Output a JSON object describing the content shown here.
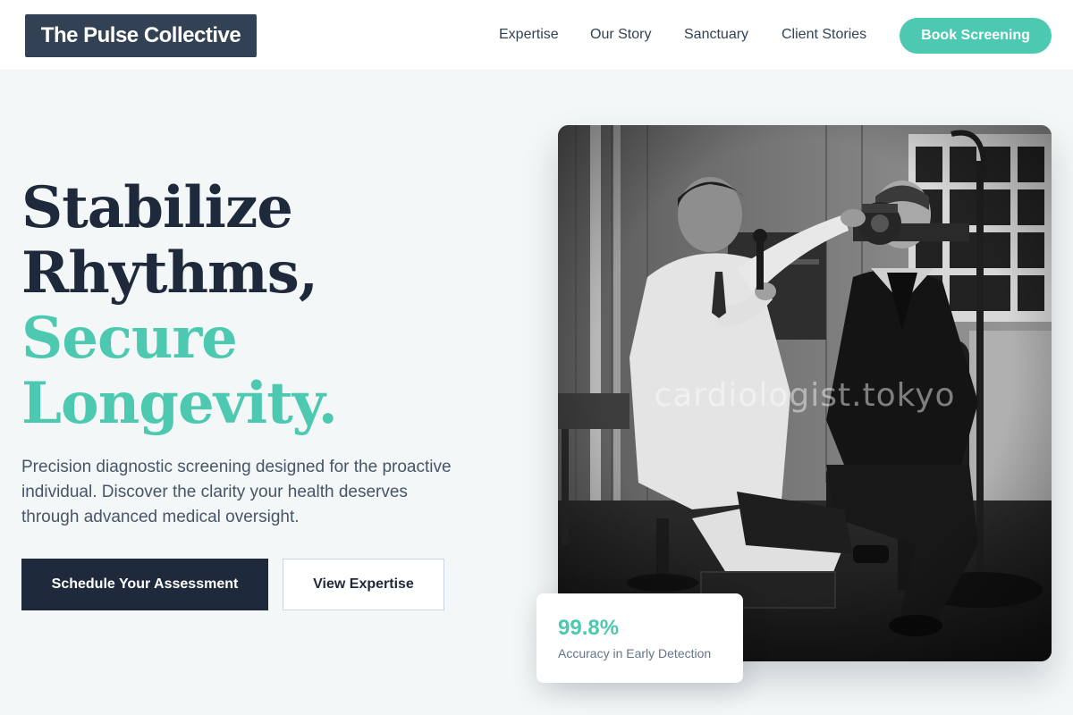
{
  "brand": {
    "name": "The Pulse Collective"
  },
  "nav": {
    "items": [
      {
        "label": "Expertise"
      },
      {
        "label": "Our Story"
      },
      {
        "label": "Sanctuary"
      },
      {
        "label": "Client Stories"
      }
    ],
    "cta_label": "Book Screening"
  },
  "hero": {
    "headline_line1": "Stabilize",
    "headline_line2": "Rhythms,",
    "headline_line3": "Secure",
    "headline_line4": "Longevity.",
    "lead": "Precision diagnostic screening designed for the proactive individual. Discover the clarity your health deserves through advanced medical oversight.",
    "primary_cta": "Schedule Your Assessment",
    "secondary_cta": "View Expertise",
    "image_watermark": "cardiologist.tokyo"
  },
  "stat": {
    "value": "99.8%",
    "label": "Accuracy in Early Detection"
  },
  "colors": {
    "accent": "#4cc9b0",
    "navy": "#1e293b",
    "logo_bg": "#334155",
    "page_bg": "#f3f7f7"
  }
}
